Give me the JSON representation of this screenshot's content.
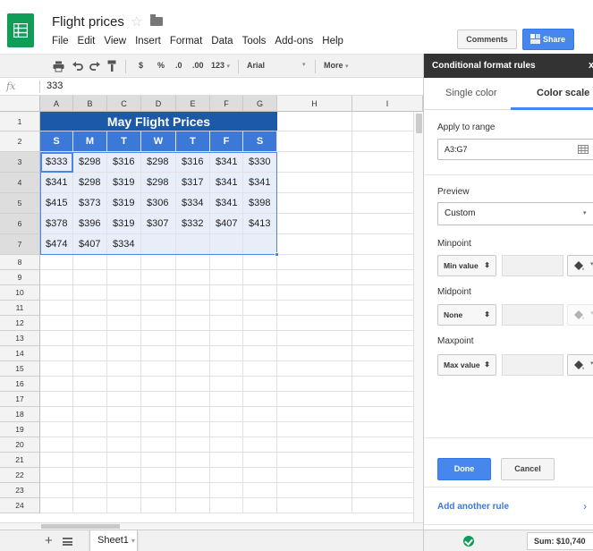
{
  "app": {
    "document_title": "Flight prices",
    "menu": [
      "File",
      "Edit",
      "View",
      "Insert",
      "Format",
      "Data",
      "Tools",
      "Add-ons",
      "Help"
    ],
    "comments_label": "Comments",
    "share_label": "Share"
  },
  "toolbar": {
    "currency": "$",
    "percent": "%",
    "decrease_decimals": ".0",
    "increase_decimals": ".00",
    "number_format": "123",
    "font": "Arial",
    "more": "More"
  },
  "formula_bar": {
    "fx": "fx",
    "value": "333"
  },
  "grid": {
    "columns": [
      "A",
      "B",
      "C",
      "D",
      "E",
      "F",
      "G",
      "H",
      "I"
    ],
    "rows": [
      "1",
      "2",
      "3",
      "4",
      "5",
      "6",
      "7",
      "8",
      "9",
      "10",
      "11",
      "12",
      "13",
      "14",
      "15",
      "16",
      "17",
      "18",
      "19",
      "20",
      "21",
      "22",
      "23",
      "24"
    ],
    "title": "May Flight Prices",
    "weekdays": [
      "S",
      "M",
      "T",
      "W",
      "T",
      "F",
      "S"
    ],
    "prices": [
      [
        "$333",
        "$298",
        "$316",
        "$298",
        "$316",
        "$341",
        "$330"
      ],
      [
        "$341",
        "$298",
        "$319",
        "$298",
        "$317",
        "$341",
        "$341"
      ],
      [
        "$415",
        "$373",
        "$319",
        "$306",
        "$334",
        "$341",
        "$398"
      ],
      [
        "$378",
        "$396",
        "$319",
        "$307",
        "$332",
        "$407",
        "$413"
      ],
      [
        "$474",
        "$407",
        "$334",
        "",
        "",
        "",
        ""
      ]
    ]
  },
  "sheet_tabs": {
    "active": "Sheet1"
  },
  "panel": {
    "title": "Conditional format rules",
    "close": "x",
    "tab_single": "Single color",
    "tab_scale": "Color scale",
    "apply_label": "Apply to range",
    "range": "A3:G7",
    "preview_label": "Preview",
    "preview_value": "Custom",
    "minpoint_label": "Minpoint",
    "minpoint_type": "Min value",
    "midpoint_label": "Midpoint",
    "midpoint_type": "None",
    "maxpoint_label": "Maxpoint",
    "maxpoint_type": "Max value",
    "done": "Done",
    "cancel": "Cancel",
    "add_rule": "Add another rule"
  },
  "status": {
    "sum": "Sum: $10,740"
  },
  "colors": {
    "accent": "#4285f4",
    "header_blue": "#1c5aa8",
    "weekday_blue": "#3c78d8",
    "selection": "#e8eef9",
    "sheets_green": "#0f9d58"
  }
}
